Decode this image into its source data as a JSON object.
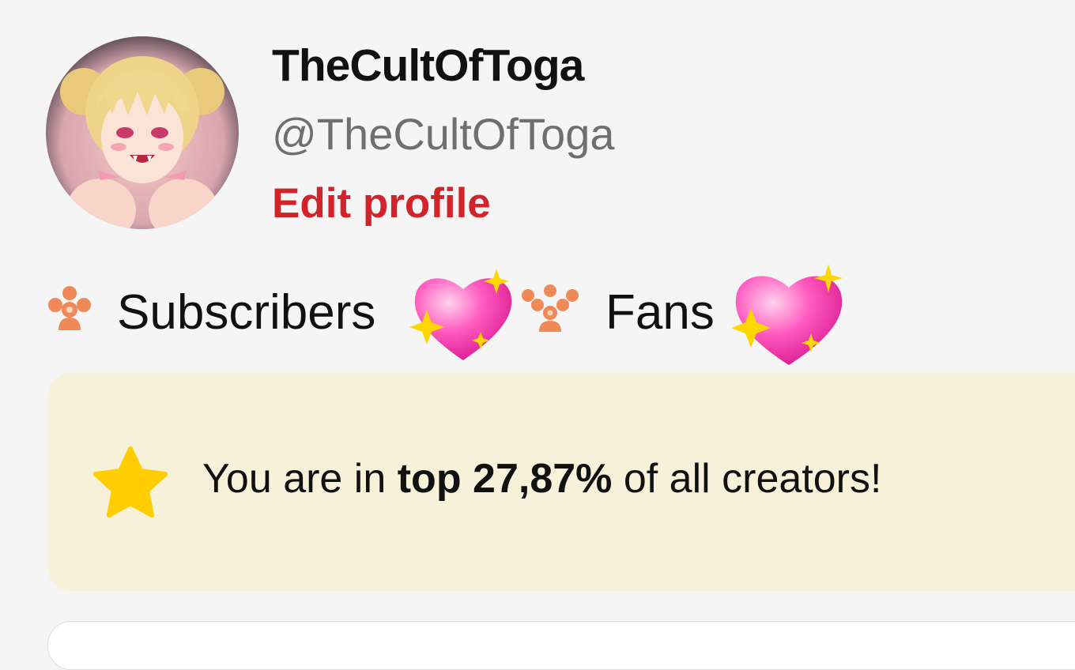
{
  "profile": {
    "display_name": "TheCultOfToga",
    "handle": "@TheCultOfToga",
    "edit_label": "Edit profile",
    "avatar_icon": "anime-avatar-image"
  },
  "stats": {
    "subscribers_label": "Subscribers",
    "fans_label": "Fans",
    "subscribers_icon": "people-group-icon",
    "fans_icon": "people-crowd-icon",
    "heart_icon": "sparkling-heart-emoji"
  },
  "rank": {
    "prefix": "You are in ",
    "highlight": "top 27,87%",
    "suffix": " of all creators!",
    "icon": "star-emoji"
  },
  "colors": {
    "background": "#f5f5f6",
    "edit_link": "#d1232a",
    "handle_text": "#6f6f6f",
    "rank_card": "#f6f1d8",
    "stat_icon": "#ef8a58",
    "heart": "#ff3fa8",
    "star": "#ffcd00"
  }
}
